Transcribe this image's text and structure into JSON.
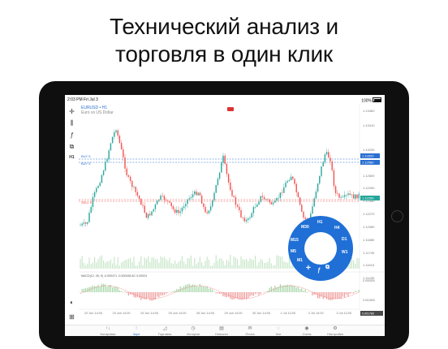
{
  "headline": {
    "line1": "Технический анализ и",
    "line2": "торговля в один клик"
  },
  "status": {
    "time": "2:03 PM",
    "date": "Fri Jul 3",
    "battery": "100%"
  },
  "chart": {
    "symbol": "EURUSD • H1",
    "description": "Euro vs US Dollar",
    "price_labels": [
      "1.13460",
      "1.13410",
      "1.13230",
      "1.13170",
      "1.12600",
      "1.12490",
      "1.12350",
      "1.12270",
      "1.12080",
      "1.11880",
      "1.11740",
      "1.11610",
      "1.11430"
    ],
    "markers": {
      "buy1": "BUY 5",
      "buy2": "BUY 5",
      "sell": "SELL 5",
      "tp1": "1.12620",
      "tp2": "1.12580",
      "current": "1.12250"
    },
    "macd_label": "MACD(12, 26, 9) -0.000471  -0.000436 AC 0.00024",
    "macd_ticks": [
      "0.000000",
      "0.001800"
    ],
    "macd_bottom": "0.001780",
    "x_labels": [
      "22 Jun 14:00",
      "23 Jun 14:00",
      "24 Jun 14:00",
      "25 Jun 14:00",
      "26 Jun 14:00",
      "29 Jun 14:00",
      "30 Jun 14:00",
      "1 Jul 14:00",
      "2 Jul 14:00",
      "3 Jul 14:00"
    ]
  },
  "wheel": {
    "labels": [
      "M30",
      "H1",
      "H4",
      "D1",
      "M15",
      "M5",
      "M1",
      "W1"
    ]
  },
  "tabs": [
    {
      "label": "Котировки",
      "icon": "↑↓"
    },
    {
      "label": "Чарт",
      "icon": "⫶"
    },
    {
      "label": "Торговля",
      "icon": "◿"
    },
    {
      "label": "История",
      "icon": "◷"
    },
    {
      "label": "Новости",
      "icon": "▤"
    },
    {
      "label": "Почта",
      "icon": "✉"
    },
    {
      "label": "Чат",
      "icon": "◌"
    },
    {
      "label": "Счета",
      "icon": "◉"
    },
    {
      "label": "Настройки",
      "icon": "⚙"
    }
  ],
  "colors": {
    "bull": "#26a69a",
    "bear": "#ef5350",
    "accent": "#2a6fd1",
    "wheel": "#1f6fd6"
  }
}
